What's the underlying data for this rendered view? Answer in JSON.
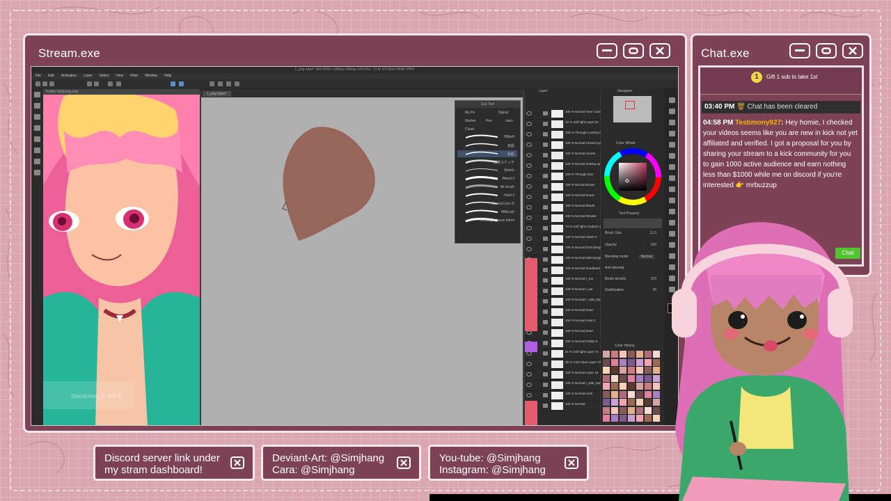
{
  "stream_window": {
    "title": "Stream.exe"
  },
  "chat_window": {
    "title": "Chat.exe",
    "gift": {
      "count": "1",
      "text": "Gift 1 sub to take 1st"
    },
    "cleared": {
      "time": "03:40 PM",
      "text": "Chat has been cleared"
    },
    "message": {
      "time": "04:58 PM",
      "user": "Testimony927",
      "text": "Hey homie, I checked your videos seems like you are new in kick not yet affiliated and verified. I got a proposal for you by sharing your stream to a kick community for you to gain 1000 active audience and earn nothing less than $1000 while me on discord if you're interested 👉 mrbuzzup"
    },
    "chat_button": "Chat"
  },
  "app": {
    "title": "1_png tuber* (A4 3508 x 2480px 300dpi 100.0%) - CLIP STUDIO PAINT PRO",
    "menu": [
      "File",
      "Edit",
      "Animation",
      "Layer",
      "Select",
      "View",
      "Filter",
      "Window",
      "Help"
    ],
    "canvas_tab": "1_png tuber*",
    "nav_tab": "Profile Simjhang.png",
    "subtool_header": "Sub Tool",
    "subtool_tabs": [
      "My Pe",
      "Signat",
      "Marker",
      "Pen",
      "cano"
    ],
    "subtool_group": "Cloud",
    "brushes": [
      "HBsoft",
      "色鉛",
      "色鉛",
      "質感スケッチ",
      "Sketch",
      "Blend 2",
      "Air brush",
      "Hard 2",
      "HBpencil (ver 2)",
      "HBbrush",
      "Rectangle brush blend"
    ],
    "layer_header": "Layer",
    "layers": [
      "100 % Normal Tone Curve 1",
      "32 % Soft light Layer 51",
      "100 % Through Looking Down",
      "100 % Normal Closed eyes",
      "100 % Normal screen",
      "100 % Normal looking up",
      "100 % Through face",
      "100 % Normal Brows",
      "100 % Normal brows",
      "100 % Normal Mouth",
      "100 % Normal Render",
      "74 % Soft light Gradient map",
      "100 % Normal cheek 2",
      "100 % Normal front bangs",
      "100 % Normal side bangs",
      "100 % Normal headband",
      "100 % Normal r_ear",
      "100 % Normal l_ear",
      "100 % Normal r_side_bangs",
      "100 % Normal head",
      "100 % Normal nose 2",
      "100 % Normal head",
      "100 % Normal Folder 9",
      "61 % Soft light Layer 71",
      "35 % Color burn Layer 37",
      "100 % Normal Layer 10",
      "100 % Normal l_side_bangs",
      "100 % Normal neck",
      "100 % Normal"
    ],
    "navigator_label": "Navigator",
    "color_wheel_label": "Color Wheel",
    "tool_property_label": "Tool Property",
    "props": [
      {
        "label": "Brush Size",
        "value": "12.0"
      },
      {
        "label": "Opacity",
        "value": "100"
      },
      {
        "label": "Blending mode",
        "value": "Normal"
      },
      {
        "label": "Anti-aliasing",
        "value": ""
      },
      {
        "label": "Brush density",
        "value": "100"
      },
      {
        "label": "Stabilization",
        "value": "25"
      }
    ],
    "color_history_label": "Color History",
    "watermark": "Ständchen, S. 560 ff."
  },
  "links": [
    {
      "line1": "Discord server link under",
      "line2": "my stram dashboard!"
    },
    {
      "line1": "Deviant-Art: @Simjhang",
      "line2": "Cara: @Simjhang"
    },
    {
      "line1": "You-tube: @Simjhang",
      "line2": "Instagram: @Simjhang"
    }
  ],
  "colors": {
    "window_bg": "#7e4257",
    "window_border": "#fbe9ee",
    "page_bg": "#d9a6b1",
    "chat_highlight": "#f4b400",
    "chat_button": "#53c431"
  }
}
